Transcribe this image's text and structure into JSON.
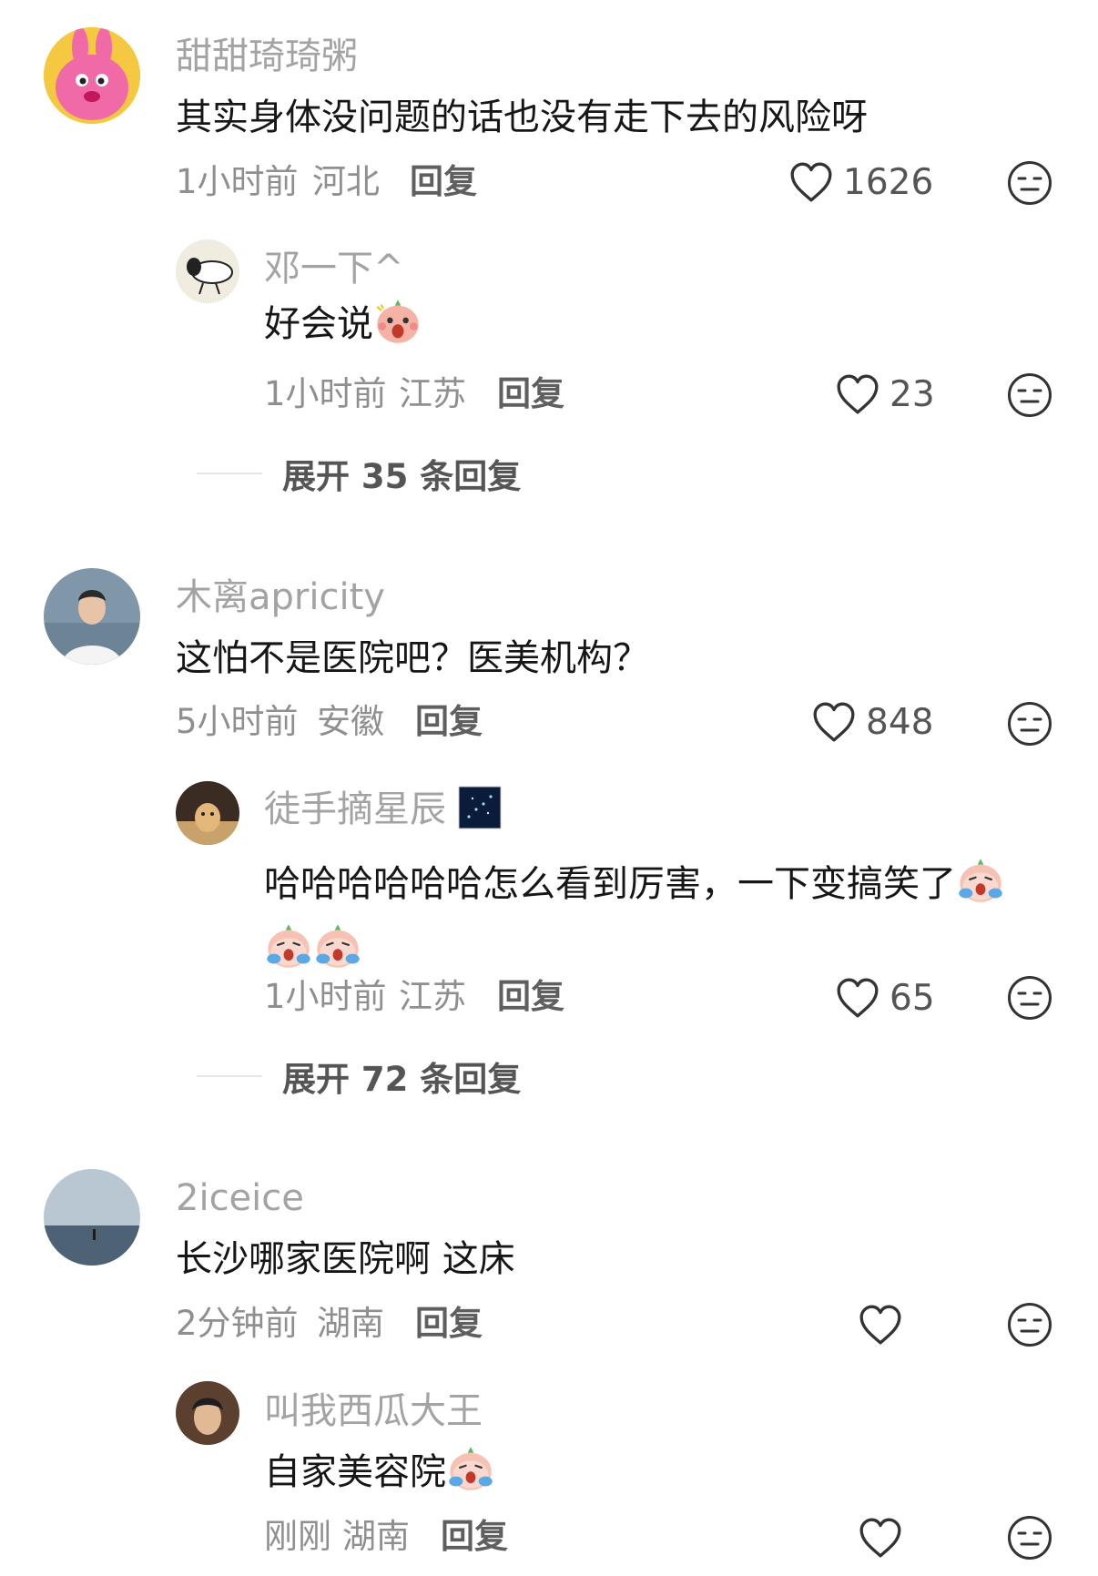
{
  "comments": [
    {
      "user": "甜甜琦琦粥",
      "text": "其实身体没问题的话也没有走下去的风险呀",
      "time": "1小时前",
      "location": "河北",
      "reply_label": "回复",
      "likes": "1626",
      "replies": [
        {
          "user": "邓一下^",
          "text": "好会说",
          "time": "1小时前",
          "location": "江苏",
          "reply_label": "回复",
          "likes": "23"
        }
      ],
      "expand_label": "展开 35 条回复"
    },
    {
      "user": "木离apricity",
      "text": "这怕不是医院吧？医美机构？",
      "time": "5小时前",
      "location": "安徽",
      "reply_label": "回复",
      "likes": "848",
      "replies": [
        {
          "user": "徒手摘星辰",
          "text": "哈哈哈哈哈哈怎么看到厉害，一下变搞笑了",
          "time": "1小时前",
          "location": "江苏",
          "reply_label": "回复",
          "likes": "65"
        }
      ],
      "expand_label": "展开 72 条回复"
    },
    {
      "user": "2iceice",
      "text": "长沙哪家医院啊 这床",
      "time": "2分钟前",
      "location": "湖南",
      "reply_label": "回复",
      "likes": "",
      "replies": [
        {
          "user": "叫我西瓜大王",
          "text": "自家美容院",
          "time": "刚刚",
          "location": "湖南",
          "reply_label": "回复",
          "likes": ""
        }
      ]
    }
  ],
  "icons": {
    "like": "heart-outline-icon",
    "dislike": "meh-face-icon",
    "emoji_crying": "crying-peach-emoji",
    "emoji_shocked": "shocked-peach-emoji",
    "emoji_stars": "starry-sky-emoji"
  },
  "colors": {
    "username": "#a3a3a3",
    "text": "#161616",
    "meta": "#8f8f8f",
    "icon": "#333333"
  }
}
